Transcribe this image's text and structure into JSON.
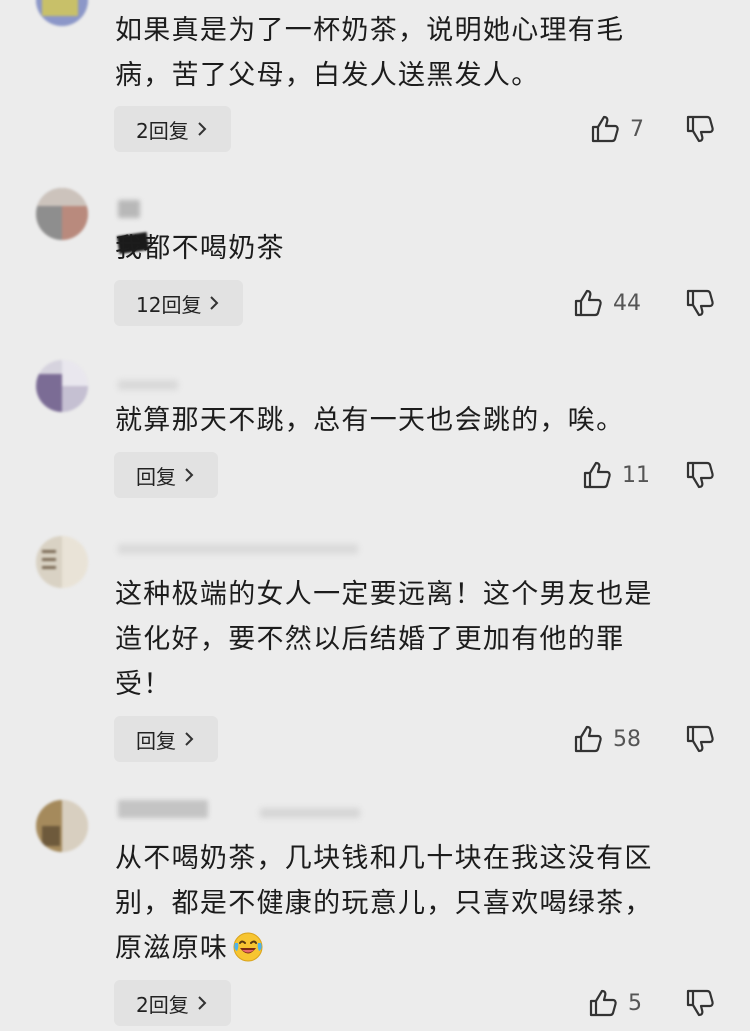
{
  "comments": [
    {
      "text_lines": [
        "如果真是为了一杯奶茶，说明她心理有毛",
        "病，苦了父母，白发人送黑发人。"
      ],
      "reply_label": "2回复",
      "likes": "7"
    },
    {
      "text_lines": [
        "我都不喝奶茶"
      ],
      "reply_label": "12回复",
      "likes": "44"
    },
    {
      "text_lines": [
        "就算那天不跳，总有一天也会跳的，唉。"
      ],
      "reply_label": "回复",
      "likes": "11"
    },
    {
      "text_lines": [
        "这种极端的女人一定要远离！这个男友也是",
        "造化好，要不然以后结婚了更加有他的罪",
        "受！"
      ],
      "reply_label": "回复",
      "likes": "58"
    },
    {
      "text_lines": [
        "从不喝奶茶，几块钱和几十块在我这没有区",
        "别，都是不健康的玩意儿，只喜欢喝绿茶，",
        "原滋原味"
      ],
      "reply_label": "2回复",
      "likes": "5",
      "emoji": "laughing-crying-emoji"
    }
  ],
  "icons": {
    "like": "thumbs-up-icon",
    "dislike": "thumbs-down-icon",
    "chevron": "chevron-right-icon"
  },
  "colors": {
    "background": "#ececec",
    "pill": "#e2e2e2",
    "text": "#1c1c1c",
    "count": "#555555"
  }
}
